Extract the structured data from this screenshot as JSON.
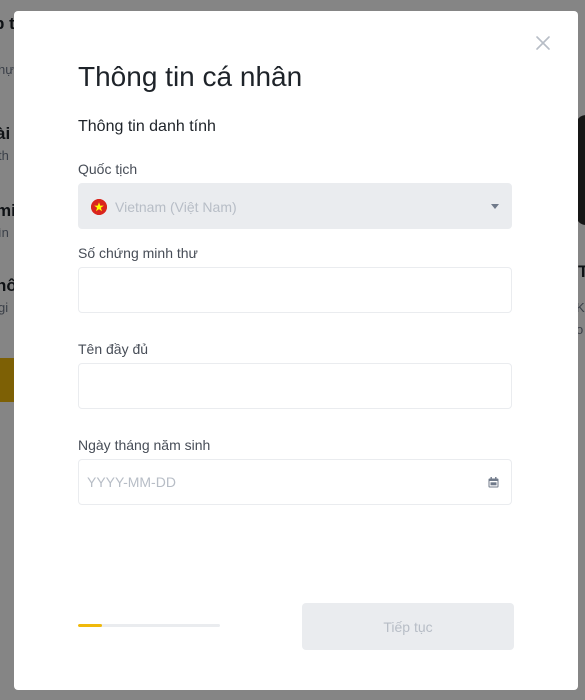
{
  "colors": {
    "accent": "#f0b90b",
    "input_border": "#eaecef",
    "disabled_text": "#b7bdc6",
    "flag_red": "#da251d",
    "flag_star": "#ffff00"
  },
  "background_page": {
    "fragments": [
      {
        "text": "p t",
        "style": "bold"
      },
      {
        "text": "hự",
        "style": "sub"
      },
      {
        "text": "ài",
        "style": "bold"
      },
      {
        "text": "th",
        "style": "sub"
      },
      {
        "text": "mi",
        "style": "bold"
      },
      {
        "text": "ìn",
        "style": "sub"
      },
      {
        "text": "hố",
        "style": "bold"
      },
      {
        "text": "gi",
        "style": "sub"
      },
      {
        "text": "Tì",
        "style": "bold"
      },
      {
        "text": "Kh",
        "style": "sub"
      },
      {
        "text": "o",
        "style": "sub"
      }
    ]
  },
  "modal": {
    "title": "Thông tin cá nhân",
    "section_title": "Thông tin danh tính",
    "close_icon": "close-icon",
    "nationality": {
      "label": "Quốc tịch",
      "value": "Vietnam (Việt Nam)",
      "flag_icon": "vietnam-flag-icon",
      "caret_icon": "caret-down-icon"
    },
    "id_number": {
      "label": "Số chứng minh thư",
      "value": "",
      "placeholder": ""
    },
    "full_name": {
      "label": "Tên đầy đủ",
      "value": "",
      "placeholder": ""
    },
    "birth_date": {
      "label": "Ngày tháng năm sinh",
      "value": "",
      "placeholder": "YYYY-MM-DD",
      "icon": "calendar-icon"
    },
    "progress": {
      "fraction": 0.17
    },
    "continue_label": "Tiếp tục"
  }
}
